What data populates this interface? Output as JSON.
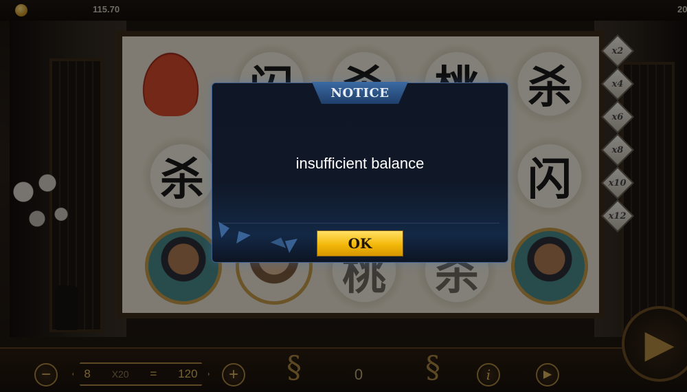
{
  "topbar": {
    "balance": "115.70",
    "right_partial": "20"
  },
  "reels": {
    "row1": [
      "money-bag",
      "闪",
      "杀",
      "桃",
      "杀"
    ],
    "row2": [
      "杀",
      "",
      "",
      "",
      "闪"
    ],
    "row3": [
      "hero",
      "hero",
      "桃",
      "杀",
      "hero"
    ]
  },
  "multipliers": [
    "x2",
    "x4",
    "x6",
    "x8",
    "x10",
    "x12"
  ],
  "bottombar": {
    "bet_lines": "8",
    "bet_multiplier": "X20",
    "bet_equals": "=",
    "bet_total": "120",
    "win_amount": "0",
    "minus_icon": "−",
    "plus_icon": "+",
    "info_icon": "i",
    "autoplay_icon": "▶",
    "spin_icon": "▶"
  },
  "dialog": {
    "title": "NOTICE",
    "message": "insufficient balance",
    "ok_label": "OK"
  },
  "colors": {
    "dialog_bg": "#0f1626",
    "ok_button": "#f3b80a",
    "gold_accent": "#a8843e"
  }
}
